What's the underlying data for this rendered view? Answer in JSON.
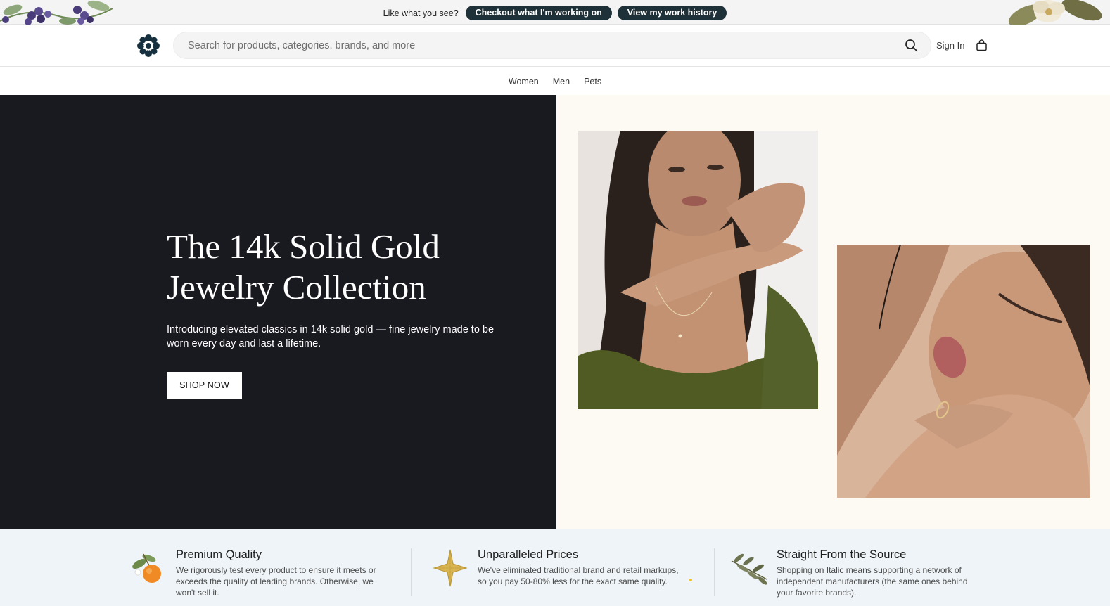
{
  "promo": {
    "text": "Like what you see?",
    "button_primary": "Checkout what I'm working on",
    "button_secondary": "View my work history"
  },
  "header": {
    "logo_icon": "flower-logo-icon",
    "search_placeholder": "Search for products, categories, brands, and more",
    "search_icon": "search-icon",
    "signin_label": "Sign In",
    "cart_icon": "shopping-bag-icon"
  },
  "nav": {
    "items": [
      "Women",
      "Men",
      "Pets"
    ]
  },
  "hero": {
    "title": "The 14k Solid Gold Jewelry Collection",
    "subtitle": "Introducing elevated classics in 14k solid gold — fine jewelry made to be worn every day and last a lifetime.",
    "cta_label": "SHOP NOW",
    "background_color": "#191920",
    "panel_color": "#fdf9f3"
  },
  "features": [
    {
      "icon": "orange-icon",
      "title": "Premium Quality",
      "description": "We rigorously test every product to ensure it meets or exceeds the quality of leading brands. Otherwise, we won't sell it."
    },
    {
      "icon": "star-icon",
      "title": "Unparalleled Prices",
      "description": "We've eliminated traditional brand and retail markups, so you pay 50-80% less for the exact same quality."
    },
    {
      "icon": "olive-branch-icon",
      "title": "Straight From the Source",
      "description": "Shopping on Italic means supporting a network of independent manufacturers (the same ones behind your favorite brands)."
    }
  ],
  "colors": {
    "accent_dark": "#1e3038",
    "features_bg": "#eef4f7"
  }
}
